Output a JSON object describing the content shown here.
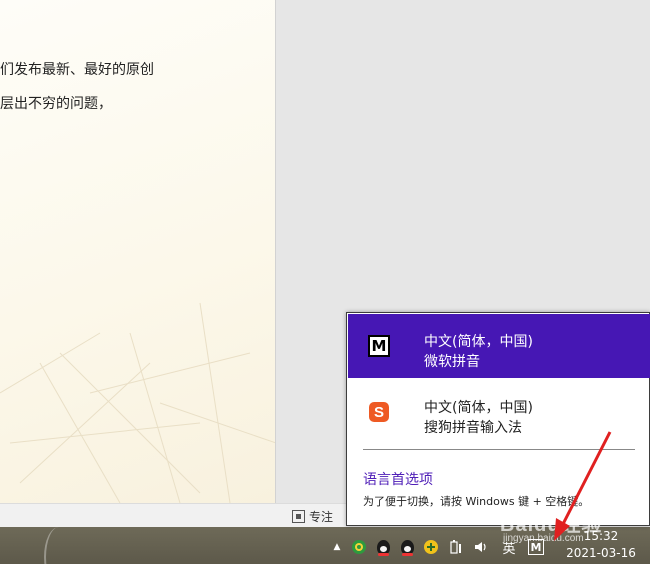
{
  "document": {
    "line1": "们发布最新、最好的原创",
    "line2": "层出不穷的问题，"
  },
  "statusbar": {
    "focus_label": "专注"
  },
  "language_popup": {
    "ime_items": [
      {
        "name": "中文(简体，中国)",
        "sub": "微软拼音",
        "icon": "M",
        "selected": true
      },
      {
        "name": "中文(简体，中国)",
        "sub": "搜狗拼音输入法",
        "icon": "S",
        "selected": false
      }
    ],
    "preferences_link": "语言首选项",
    "hint": "为了便于切换，请按 Windows 键 + 空格键。"
  },
  "taskbar": {
    "tray_arrow": "▲",
    "lang_indicator": "英",
    "ime_mode": "M",
    "time": "15:32",
    "date": "2021-03-16"
  },
  "watermark": {
    "brand": "Baidu经验",
    "site": "jingyan.baidu.com"
  },
  "colors": {
    "selected_bg": "#4617b4",
    "link": "#5020b8",
    "arrow": "#e02020",
    "taskbar": "#625e4e"
  }
}
